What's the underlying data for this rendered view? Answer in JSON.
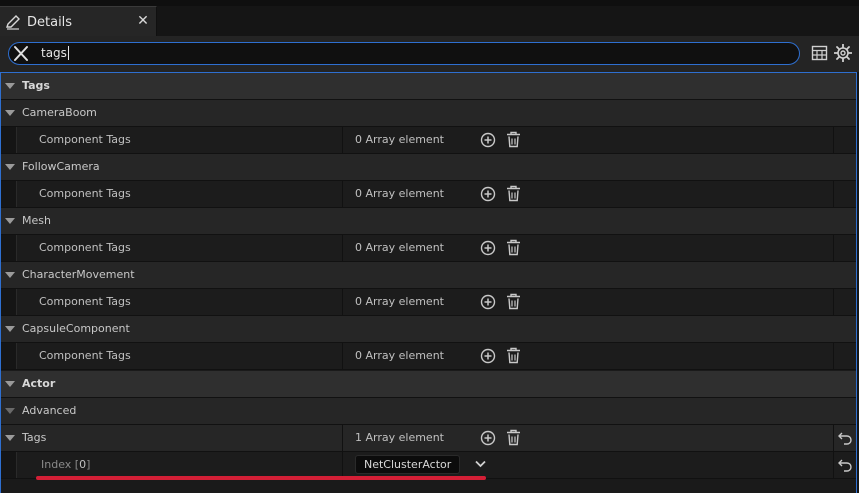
{
  "tab": {
    "title": "Details",
    "close_glyph": "✕",
    "icon": "pencil-icon"
  },
  "search": {
    "value": "tags",
    "clear_icon": "close-icon"
  },
  "toolbar": {
    "table_icon": "table-view-icon",
    "settings_icon": "gear-icon"
  },
  "rows": [
    {
      "kind": "category",
      "label": "Tags"
    },
    {
      "kind": "component",
      "label": "CameraBoom"
    },
    {
      "kind": "property",
      "label": "Component Tags",
      "value": "0 Array element"
    },
    {
      "kind": "component",
      "label": "FollowCamera"
    },
    {
      "kind": "property",
      "label": "Component Tags",
      "value": "0 Array element"
    },
    {
      "kind": "component",
      "label": "Mesh"
    },
    {
      "kind": "property",
      "label": "Component Tags",
      "value": "0 Array element"
    },
    {
      "kind": "component",
      "label": "CharacterMovement"
    },
    {
      "kind": "property",
      "label": "Component Tags",
      "value": "0 Array element"
    },
    {
      "kind": "component",
      "label": "CapsuleComponent"
    },
    {
      "kind": "property",
      "label": "Component Tags",
      "value": "0 Array element"
    },
    {
      "kind": "category",
      "label": "Actor"
    },
    {
      "kind": "advanced",
      "label": "Advanced"
    },
    {
      "kind": "array",
      "label": "Tags",
      "value": "1 Array element"
    },
    {
      "kind": "element",
      "label_prefix": "Index [",
      "index": "0",
      "label_suffix": "]",
      "value": "NetClusterActor"
    }
  ],
  "colors": {
    "accent": "#2e6fd0",
    "highlight": "#d41f36",
    "panel_bg": "#1a1a1a"
  }
}
